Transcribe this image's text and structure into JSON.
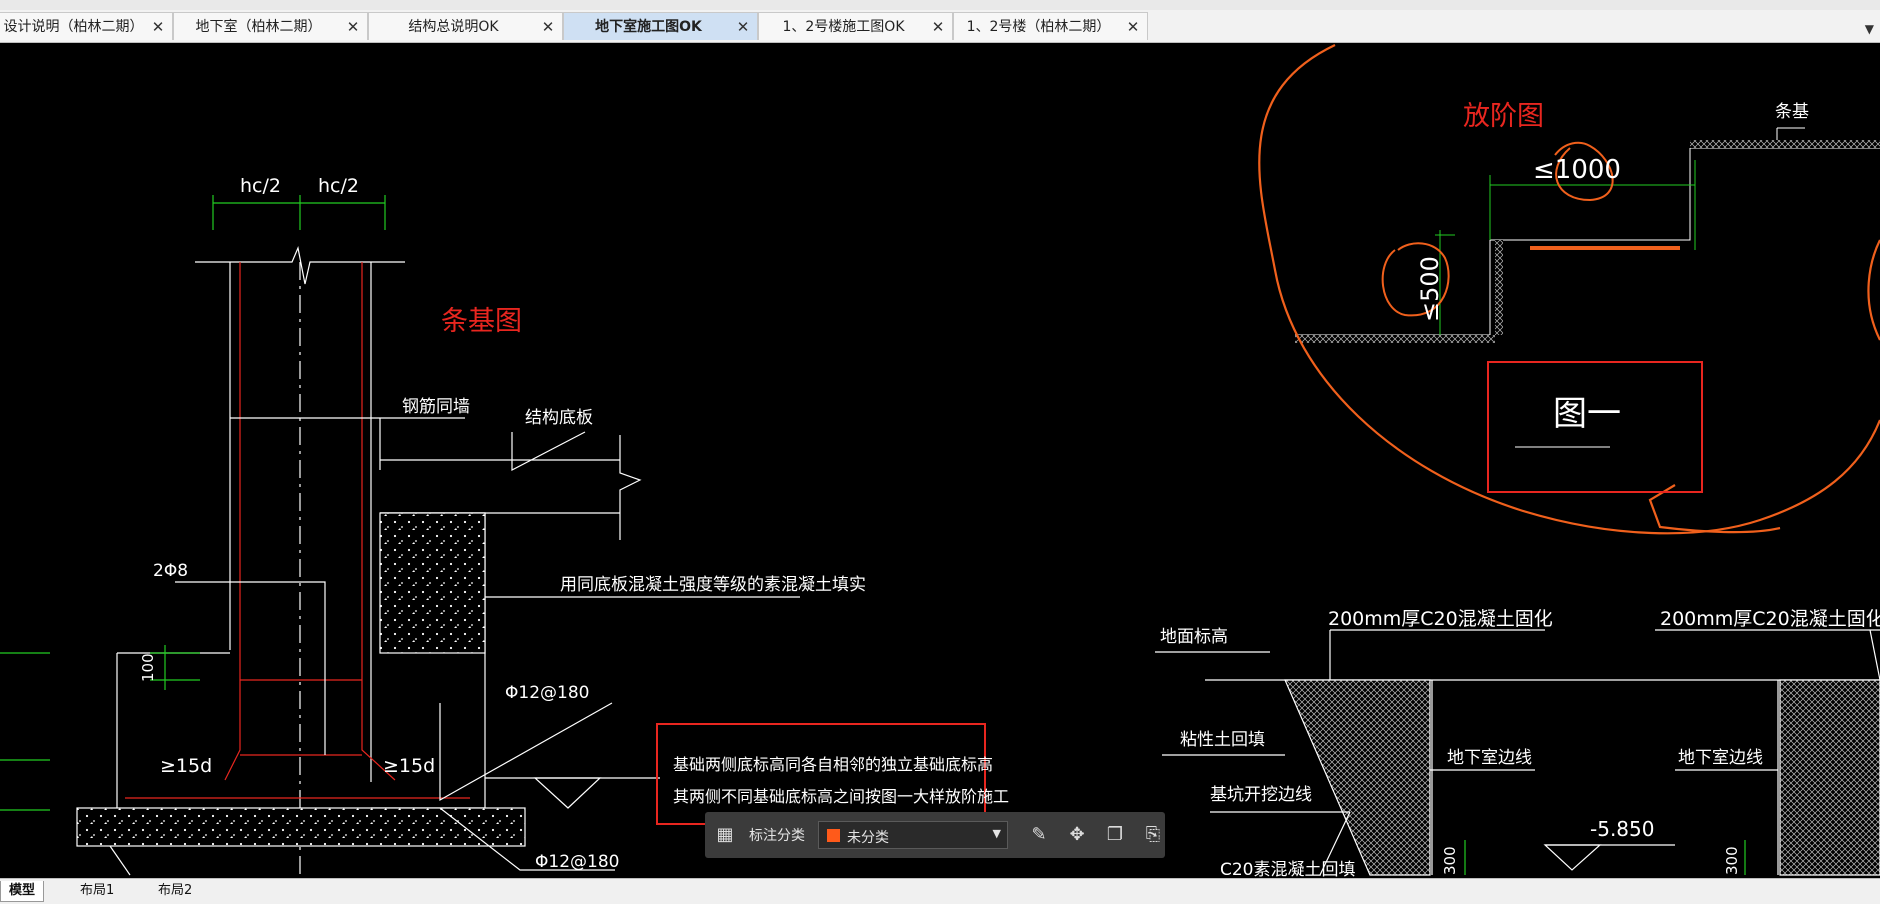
{
  "tabs": [
    {
      "label": "设计说明（柏林二期）",
      "active": false
    },
    {
      "label": "地下室（柏林二期）",
      "active": false
    },
    {
      "label": "结构总说明OK",
      "active": false
    },
    {
      "label": "地下室施工图OK",
      "active": true
    },
    {
      "label": "1、2号楼施工图OK",
      "active": false
    },
    {
      "label": "1、2号楼（柏林二期）",
      "active": false
    }
  ],
  "tab_close_glyph": "✕",
  "tab_menu_glyph": "▼",
  "drawing": {
    "left_title": "条基图",
    "right_title": "放阶图",
    "dim_hc_left": "hc/2",
    "dim_hc_right": "hc/2",
    "label_rebar_wall": "钢筋同墙",
    "label_slab": "结构底板",
    "label_fill": "用同底板混凝土强度等级的素混凝土填实",
    "label_2phi8": "2Φ8",
    "label_100": "100",
    "label_15d_left": "≥15d",
    "label_15d_right": "≥15d",
    "label_phi12_top": "Φ12@180",
    "label_phi12_bottom": "Φ12@180",
    "note_line1": "基础两侧底标高同各自相邻的独立基础底标高",
    "note_line2": "其两侧不同基础底标高之间按图一大样放阶施工",
    "label_strip": "条基",
    "label_1000": "≤1000",
    "label_500": "≤500",
    "label_fig1": "图一",
    "label_200_left": "200mm厚C20混凝土固化",
    "label_200_right": "200mm厚C20混凝土固化",
    "label_ground": "地面标高",
    "label_clay": "粘性土回填",
    "label_basement_left": "地下室边线",
    "label_basement_right": "地下室边线",
    "label_excavation": "基坑开挖边线",
    "label_elev": "-5.850",
    "label_c20": "C20素混凝土回填",
    "label_300_left": "300",
    "label_300_right": "300"
  },
  "toolbar": {
    "grid_icon": "grid-icon",
    "label": "标注分类",
    "category": "未分类",
    "category_color": "#ff5a1a",
    "caret": "▼",
    "buttons": [
      "edit-icon",
      "move-icon",
      "copy-icon",
      "paste-icon"
    ]
  },
  "bottom_tabs": [
    {
      "label": "模型",
      "active": true
    },
    {
      "label": "布局1",
      "active": false
    },
    {
      "label": "布局2",
      "active": false
    }
  ],
  "colors": {
    "annotation_red": "#e8261f",
    "markup_orange": "#f0601c",
    "dimension_green": "#22cc22",
    "cad_white": "#ffffff"
  }
}
